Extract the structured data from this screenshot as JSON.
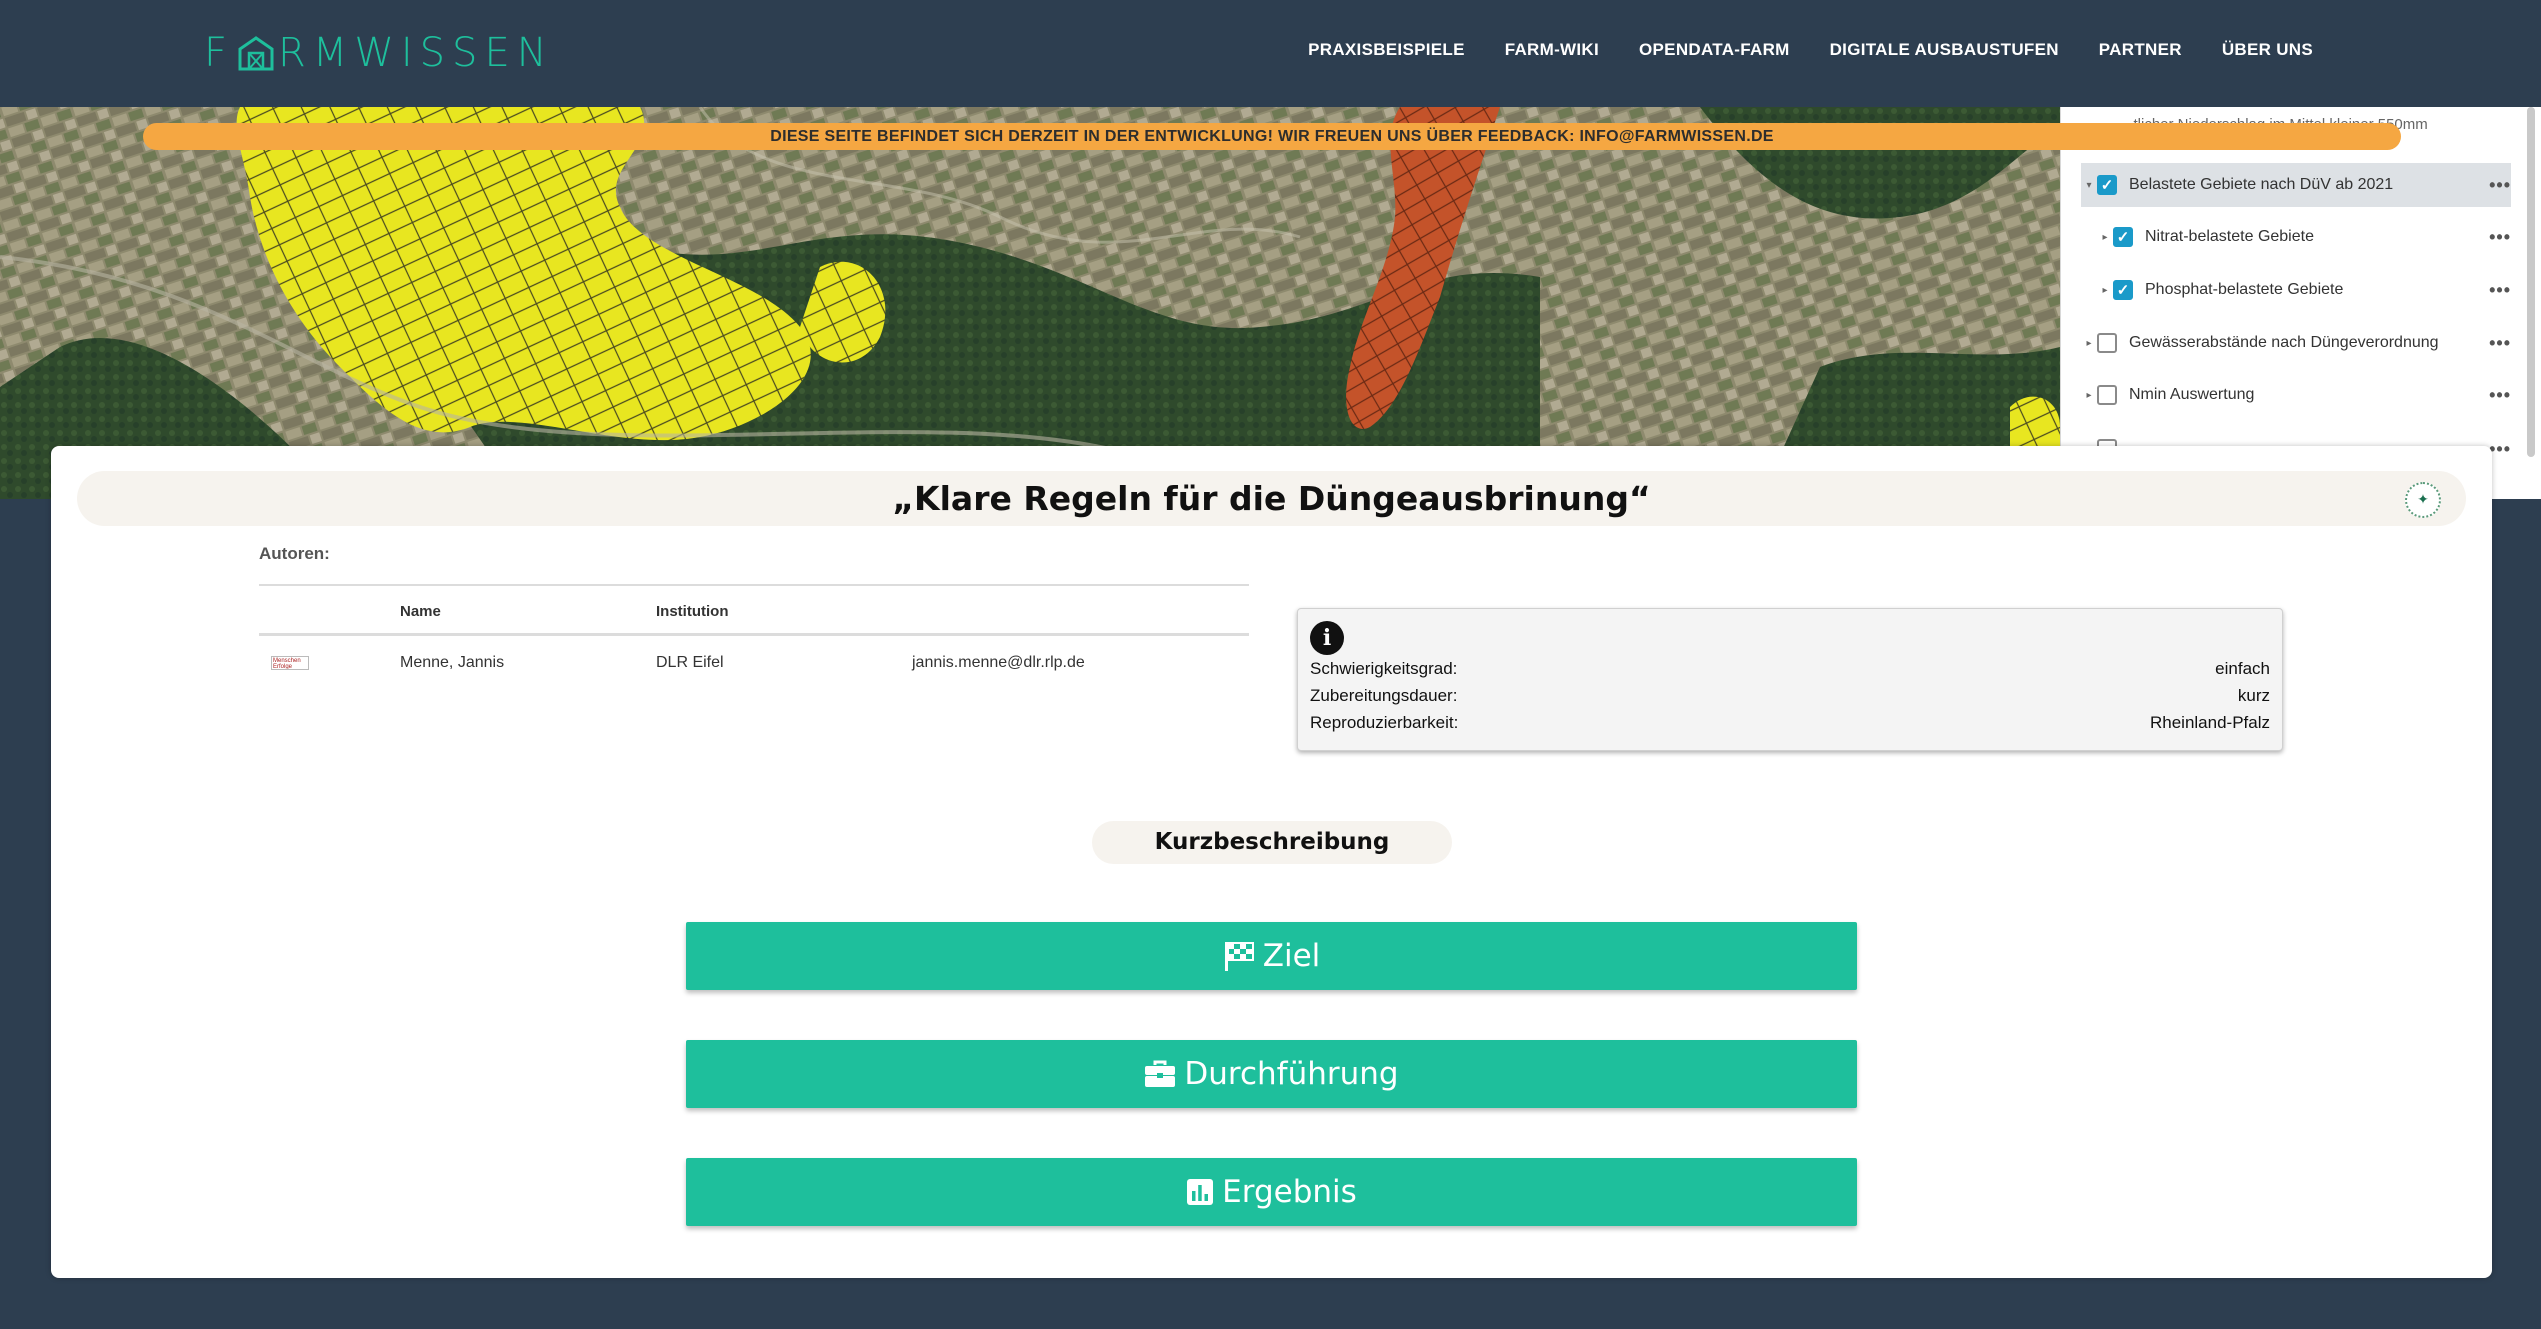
{
  "nav": {
    "logo": "FARMWISSEN",
    "links": [
      "PRAXISBEISPIELE",
      "FARM-WIKI",
      "OPENDATA-FARM",
      "DIGITALE AUSBAUSTUFEN",
      "PARTNER",
      "ÜBER UNS"
    ]
  },
  "banner": "DIESE SEITE BEFINDET SICH DERZEIT IN DER ENTWICKLUNG! WIR FREUEN UNS ÜBER FEEDBACK: INFO@FARMWISSEN.DE",
  "layers": {
    "partial_top": "...tlicher Niederschlag im Mittel kleiner 550mm",
    "items": [
      {
        "label": "Belastete Gebiete nach DüV ab 2021",
        "checked": true,
        "indent": 0,
        "selected": true
      },
      {
        "label": "Nitrat-belastete Gebiete",
        "checked": true,
        "indent": 1,
        "selected": false
      },
      {
        "label": "Phosphat-belastete Gebiete",
        "checked": true,
        "indent": 1,
        "selected": false
      },
      {
        "label": "Gewässerabstände nach Düngeverordnung",
        "checked": false,
        "indent": 0,
        "selected": false
      },
      {
        "label": "Nmin Auswertung",
        "checked": false,
        "indent": 0,
        "selected": false
      }
    ]
  },
  "card": {
    "title": "„Klare Regeln für die Düngeausbrinung“",
    "authors_label": "Autoren:",
    "table": {
      "headers": {
        "name": "Name",
        "institution": "Institution"
      },
      "rows": [
        {
          "logo_text": "Menschen Erfolge",
          "name": "Menne, Jannis",
          "institution": "DLR Eifel",
          "email": "jannis.menne@dlr.rlp.de"
        }
      ]
    },
    "info": {
      "rows": [
        {
          "key": "Schwierigkeitsgrad:",
          "value": "einfach"
        },
        {
          "key": "Zubereitungsdauer:",
          "value": "kurz"
        },
        {
          "key": "Reproduzierbarkeit:",
          "value": "Rheinland-Pfalz"
        }
      ]
    },
    "short_description": "Kurzbeschreibung",
    "buttons": {
      "ziel": {
        "label": "Ziel",
        "icon": "checkered-flag-icon"
      },
      "durchfuehrung": {
        "label": "Durchführung",
        "icon": "briefcase-icon"
      },
      "ergebnis": {
        "label": "Ergebnis",
        "icon": "bar-chart-icon"
      }
    }
  },
  "colors": {
    "navy": "#2d3e50",
    "accent": "#1ebf9c",
    "banner": "#f5a742",
    "checkbox": "#1a9ac9"
  }
}
